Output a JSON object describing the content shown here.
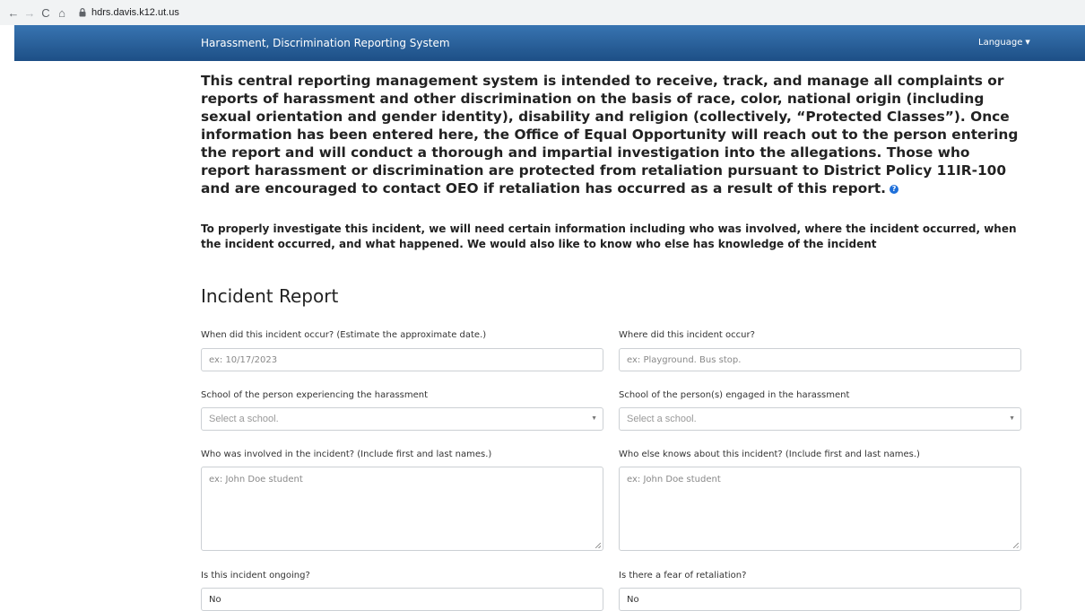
{
  "browser": {
    "url": "hdrs.davis.k12.ut.us"
  },
  "navbar": {
    "title": "Harassment, Discrimination Reporting System",
    "language_label": "Language"
  },
  "intro": {
    "paragraph1": "This central reporting management system is intended to receive, track, and manage all complaints or reports of harassment and other discrimination on the basis of race, color, national origin (including sexual orientation and gender identity), disability and religion (collectively, “Protected Classes”). Once information has been entered here, the Office of Equal Opportunity will reach out to the person entering the report and will conduct a thorough and impartial investigation into the allegations. Those who report harassment or discrimination are protected from retaliation pursuant to District Policy 11IR-100 and are encouraged to contact OEO if retaliation has occurred as a result of this report.",
    "paragraph2": "To properly investigate this incident, we will need certain information including who was involved, where the incident occurred, when the incident occurred, and what happened. We would also like to know who else has knowledge of the incident"
  },
  "form": {
    "title": "Incident Report",
    "when_label": "When did this incident occur? (Estimate the approximate date.)",
    "when_placeholder": "ex: 10/17/2023",
    "where_label": "Where did this incident occur?",
    "where_placeholder": "ex: Playground. Bus stop.",
    "school_experiencing_label": "School of the person experiencing the harassment",
    "school_experiencing_value": "Select a school.",
    "school_engaged_label": "School of the person(s) engaged in the harassment",
    "school_engaged_value": "Select a school.",
    "involved_label": "Who was involved in the incident? (Include first and last names.)",
    "involved_placeholder": "ex: John Doe student",
    "knows_label": "Who else knows about this incident? (Include first and last names.)",
    "knows_placeholder": "ex: John Doe student",
    "ongoing_label": "Is this incident ongoing?",
    "ongoing_value": "No",
    "retaliation_label": "Is there a fear of retaliation?",
    "retaliation_value": "No"
  }
}
